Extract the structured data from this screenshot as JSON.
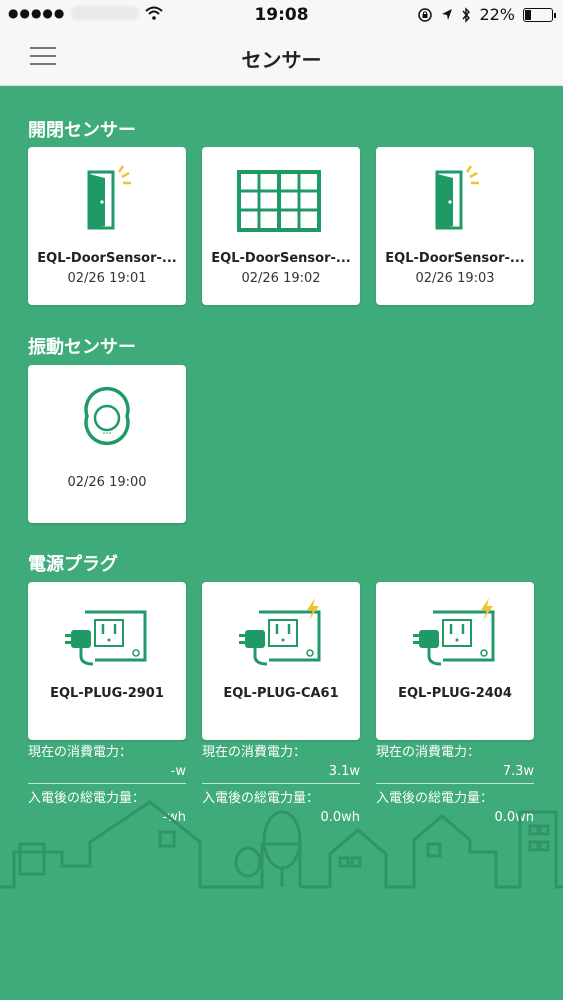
{
  "status_bar": {
    "signal": "●●●●●",
    "time": "19:08",
    "battery": "22%"
  },
  "nav": {
    "title": "センサー",
    "menu_icon": "hamburger-menu-icon"
  },
  "sections": {
    "door": {
      "title": "開閉センサー",
      "items": [
        {
          "name": "EQL-DoorSensor-...",
          "date": "02/26 19:01",
          "icon": "door-open-icon"
        },
        {
          "name": "EQL-DoorSensor-...",
          "date": "02/26 19:02",
          "icon": "window-icon"
        },
        {
          "name": "EQL-DoorSensor-...",
          "date": "02/26 19:03",
          "icon": "door-open-icon"
        }
      ]
    },
    "vibration": {
      "title": "振動センサー",
      "items": [
        {
          "name": "",
          "date": "02/26 19:00",
          "icon": "vibration-sensor-icon"
        }
      ]
    },
    "plug": {
      "title": "電源プラグ",
      "power_label": "現在の消費電力：",
      "energy_label": "入電後の総電力量：",
      "items": [
        {
          "name": "EQL-PLUG-2901",
          "power": "-w",
          "energy": "-wh",
          "icon": "plug-outlet-icon"
        },
        {
          "name": "EQL-PLUG-CA61",
          "power": "3.1w",
          "energy": "0.0wh",
          "icon": "plug-outlet-active-icon"
        },
        {
          "name": "EQL-PLUG-2404",
          "power": "7.3w",
          "energy": "0.0wh",
          "icon": "plug-outlet-active-icon"
        }
      ]
    }
  },
  "colors": {
    "background": "#3fab7a",
    "icon_green": "#1f9a67",
    "accent_yellow": "#f2c12e"
  }
}
